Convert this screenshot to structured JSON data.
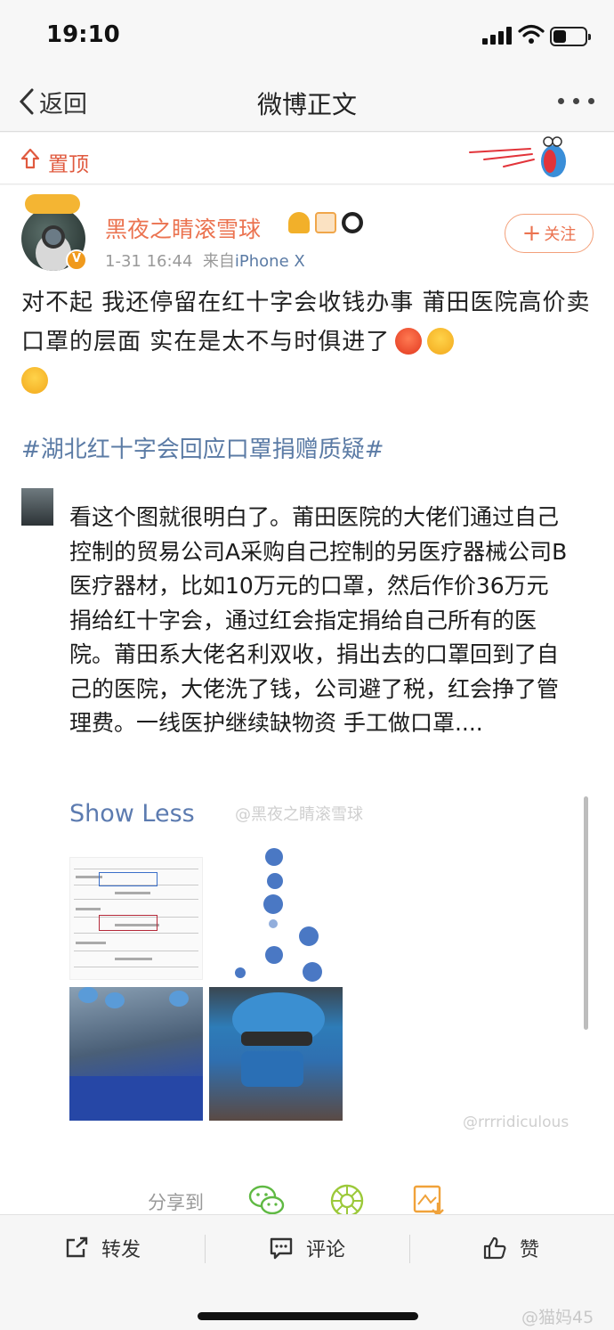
{
  "status_bar": {
    "time": "19:10"
  },
  "nav": {
    "back_label": "返回",
    "title": "微博正文"
  },
  "pin": {
    "label": "置顶"
  },
  "post": {
    "username": "黑夜之睛滚雪球",
    "timestamp": "1-31 16:44",
    "source_prefix": "来自",
    "device": "iPhone X",
    "follow_label": "关注",
    "text": "对不起 我还停留在红十字会收钱办事 莆田医院高价卖口罩的层面 实在是太不与时俱进了",
    "hashtag": "#湖北红十字会回应口罩捐赠质疑#"
  },
  "embedded": {
    "text": "看这个图就很明白了。莆田医院的大佬们通过自己控制的贸易公司A采购自己控制的另医疗器械公司B医疗器材，比如10万元的口罩，然后作价36万元捐给红十字会，通过红会指定捐给自己所有的医院。莆田系大佬名利双收，捐出去的口罩回到了自己的医院，大佬洗了钱，公司避了税，红会挣了管理费。一线医护继续缺物资 手工做口罩....",
    "show_less": "Show Less",
    "watermark_1": "@黑夜之睛滚雪球",
    "watermark_2": "@rrrridiculous"
  },
  "share": {
    "label": "分享到"
  },
  "actions": {
    "repost": "转发",
    "comment": "评论",
    "like": "赞"
  },
  "watermark_bottom": "@猫妈45"
}
